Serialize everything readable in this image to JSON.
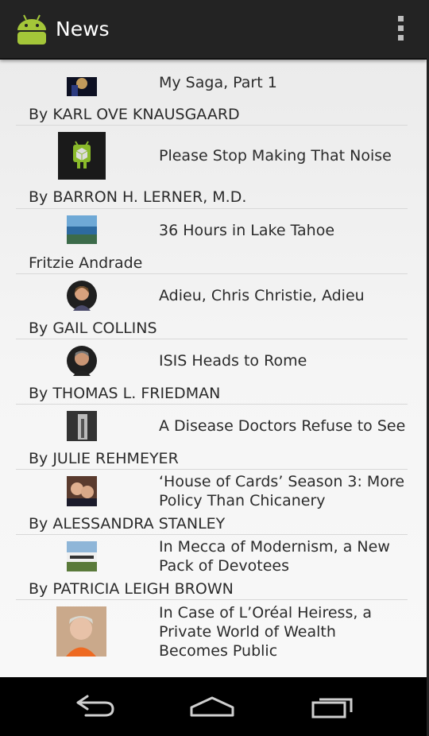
{
  "app": {
    "title": "News",
    "icon": "android-robot-icon",
    "menu_icon": "overflow-menu-icon"
  },
  "articles": [
    {
      "headline": "My Saga, Part 1",
      "byline": "By KARL OVE KNAUSGAARD",
      "thumb": "photo-night-figure"
    },
    {
      "headline": "Please Stop Making That Noise",
      "byline": "By BARRON H. LERNER, M.D.",
      "thumb": "android-placeholder-icon"
    },
    {
      "headline": "36 Hours in Lake Tahoe",
      "byline": "Fritzie Andrade",
      "thumb": "photo-lake"
    },
    {
      "headline": "Adieu, Chris Christie, Adieu",
      "byline": "By GAIL COLLINS",
      "thumb": "photo-author-woman"
    },
    {
      "headline": "ISIS Heads to Rome",
      "byline": "By THOMAS L. FRIEDMAN",
      "thumb": "photo-author-man"
    },
    {
      "headline": "A Disease Doctors Refuse to See",
      "byline": "By JULIE REHMEYER",
      "thumb": "photo-doorway"
    },
    {
      "headline": "‘House of Cards’ Season 3: More Policy Than Chicanery",
      "byline": "By ALESSANDRA STANLEY",
      "thumb": "photo-couple"
    },
    {
      "headline": "In Mecca of Modernism, a New Pack of Devotees",
      "byline": "By PATRICIA LEIGH BROWN",
      "thumb": "photo-modern-house"
    },
    {
      "headline": "In Case of L’Oréal Heiress, a Private World of Wealth Becomes Public",
      "byline": "",
      "thumb": "photo-heiress"
    }
  ],
  "navigation": {
    "back": "back-icon",
    "home": "home-icon",
    "recents": "recents-icon"
  }
}
